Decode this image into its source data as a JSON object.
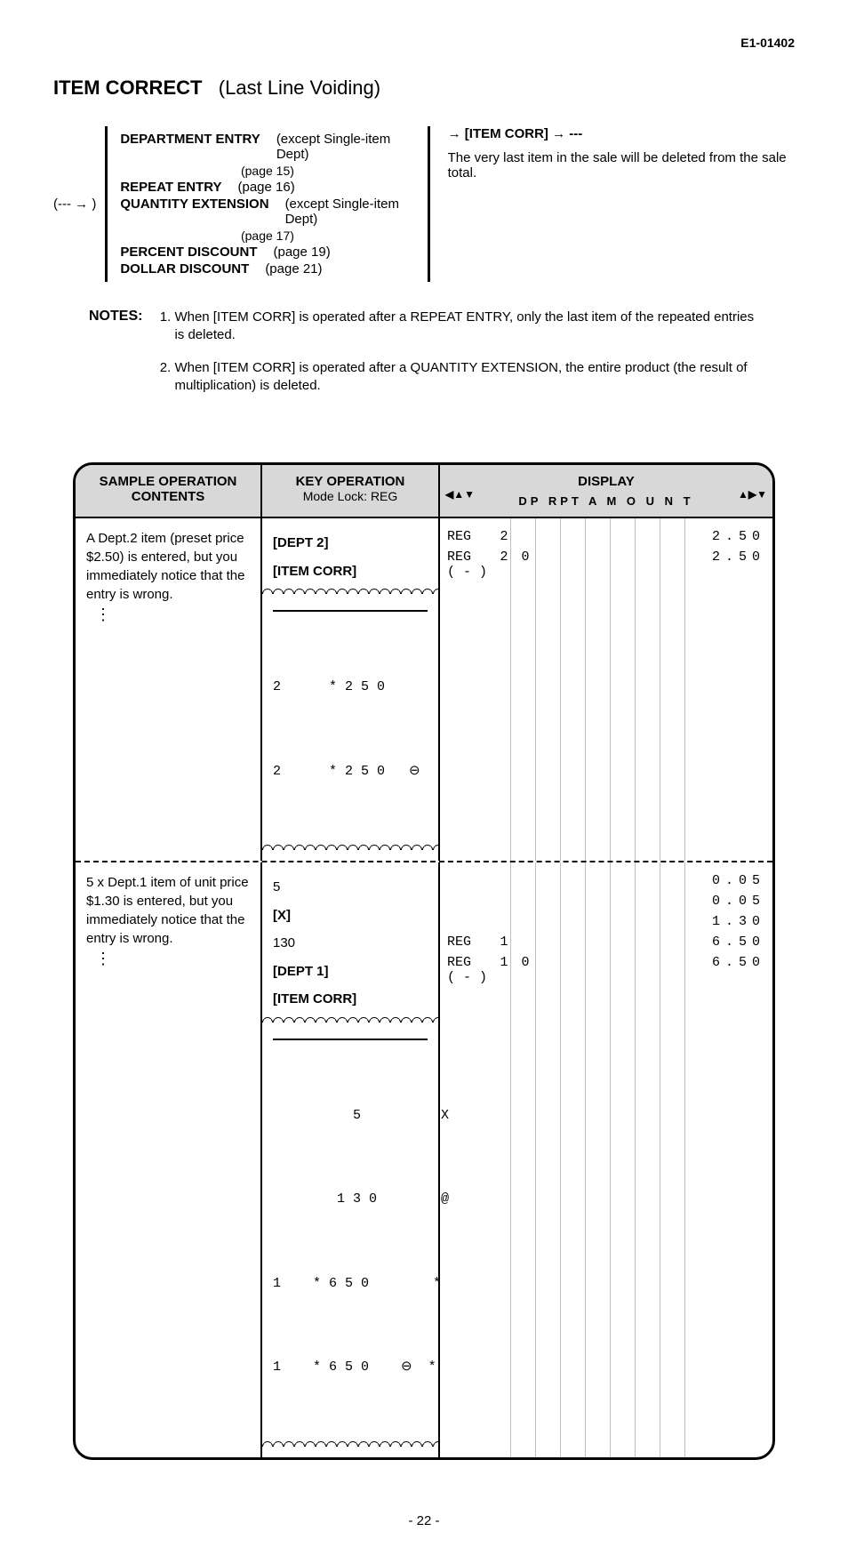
{
  "doc_id": "E1-01402",
  "title_bold": "ITEM CORRECT",
  "title_rest": "(Last Line Voiding)",
  "diagram": {
    "left": "(--- → )",
    "items": [
      {
        "label": "DEPARTMENT ENTRY",
        "note": "(except Single-item Dept)",
        "sub": "(page 15)"
      },
      {
        "label": "REPEAT ENTRY",
        "note": "",
        "sub": "(page 16)"
      },
      {
        "label": "QUANTITY EXTENSION",
        "note": "(except Single-item Dept)",
        "sub": "(page 17)"
      },
      {
        "label": "PERCENT DISCOUNT",
        "note": "",
        "sub": "(page 19)"
      },
      {
        "label": "DOLLAR DISCOUNT",
        "note": "",
        "sub": "(page 21)"
      }
    ],
    "right_hdr": "→ [ITEM CORR] → ---",
    "right_body": "The very last item in the sale will be deleted from the sale total."
  },
  "notes_label": "NOTES:",
  "notes": [
    "When [ITEM CORR] is operated after a REPEAT ENTRY, only the last item of the repeated entries is deleted.",
    "When [ITEM CORR] is operated after a QUANTITY EXTENSION, the entire product (the result of multiplication) is deleted."
  ],
  "sample_headers": {
    "a": "SAMPLE OPERATION CONTENTS",
    "b": "KEY OPERATION",
    "b_sub": "Mode Lock: REG",
    "c": "DISPLAY",
    "c_cols": "DP RPT A M O U N T"
  },
  "rows": [
    {
      "contents": "A Dept.2 item (preset price $2.50) is entered, but you immediately notice that the entry is wrong.",
      "key_ops": [
        "[DEPT 2]",
        "[ITEM CORR]"
      ],
      "receipt": [
        "2      * 2 5 0",
        "2      * 2 5 0   ⊖"
      ],
      "display": [
        {
          "mode": "REG",
          "dp": "2",
          "rpt": "",
          "amt": "2.50"
        },
        {
          "mode": "REG\n( - )",
          "dp": "2",
          "rpt": "0",
          "amt": "2.50"
        }
      ]
    },
    {
      "contents": "5 x Dept.1 item of unit price $1.30 is entered, but you immediately notice that the entry is wrong.",
      "key_ops": [
        "5",
        "[X]",
        "130",
        "[DEPT 1]",
        "[ITEM CORR]"
      ],
      "receipt": [
        "          5          X",
        "        1 3 0        @",
        "1    * 6 5 0        *",
        "1    * 6 5 0    ⊖  *"
      ],
      "display": [
        {
          "mode": "",
          "dp": "",
          "rpt": "",
          "amt": "0.05"
        },
        {
          "mode": "",
          "dp": "",
          "rpt": "",
          "amt": "0.05"
        },
        {
          "mode": "",
          "dp": "",
          "rpt": "",
          "amt": "1.30"
        },
        {
          "mode": "REG",
          "dp": "1",
          "rpt": "",
          "amt": "6.50"
        },
        {
          "mode": "REG\n( - )",
          "dp": "1",
          "rpt": "0",
          "amt": "6.50"
        }
      ]
    }
  ],
  "page_number": "- 22 -"
}
